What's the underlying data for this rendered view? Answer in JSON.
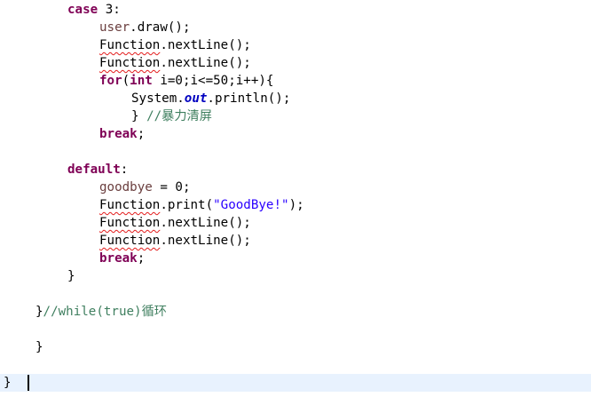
{
  "editor": {
    "lines": {
      "l1": {
        "kw": "case",
        "rest": " 3:"
      },
      "l2": {
        "obj": "user",
        "rest": ".draw();"
      },
      "l3": {
        "cls": "Function",
        "rest": ".nextLine();"
      },
      "l4": {
        "cls": "Function",
        "rest": ".nextLine();"
      },
      "l5": {
        "kw1": "for",
        "p1": "(",
        "kw2": "int",
        "rest": " i=0;i<=50;i++){"
      },
      "l6": {
        "a": "System.",
        "field": "out",
        "b": ".println();"
      },
      "l7": {
        "brace": "} ",
        "comment": "//暴力清屏"
      },
      "l8": {
        "kw": "break",
        "rest": ";"
      },
      "l9": {
        "kw": "default",
        "rest": ":"
      },
      "l10": {
        "var": "goodbye",
        "rest": " = 0;"
      },
      "l11": {
        "cls": "Function",
        "a": ".print(",
        "str": "\"GoodBye!\"",
        "b": ");"
      },
      "l12": {
        "cls": "Function",
        "rest": ".nextLine();"
      },
      "l13": {
        "cls": "Function",
        "rest": ".nextLine();"
      },
      "l14": {
        "kw": "break",
        "rest": ";"
      },
      "l15": {
        "text": "}"
      },
      "l16": {
        "brace": "}",
        "comment": "//while(true)循环"
      },
      "l17": {
        "text": "}"
      },
      "l18": {
        "text": "}"
      }
    }
  },
  "colors": {
    "keyword": "#7f0055",
    "field": "#6a3e3e",
    "string": "#2a00ff",
    "comment": "#3f7f5f",
    "static_field": "#0000c0",
    "current_line": "#e8f2fe",
    "error_underline": "#e31b1b"
  }
}
